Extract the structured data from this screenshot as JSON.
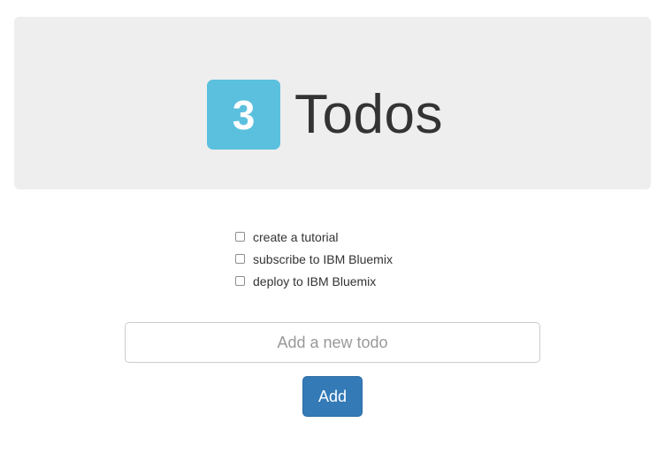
{
  "header": {
    "count": "3",
    "title": "Todos"
  },
  "todos": [
    {
      "label": "create a tutorial",
      "checked": false
    },
    {
      "label": "subscribe to IBM Bluemix",
      "checked": false
    },
    {
      "label": "deploy to IBM Bluemix",
      "checked": false
    }
  ],
  "new_todo": {
    "placeholder": "Add a new todo",
    "value": ""
  },
  "add_button": {
    "label": "Add"
  },
  "colors": {
    "badge": "#5bc0de",
    "jumbotron": "#eeeeee",
    "button": "#337ab7"
  }
}
